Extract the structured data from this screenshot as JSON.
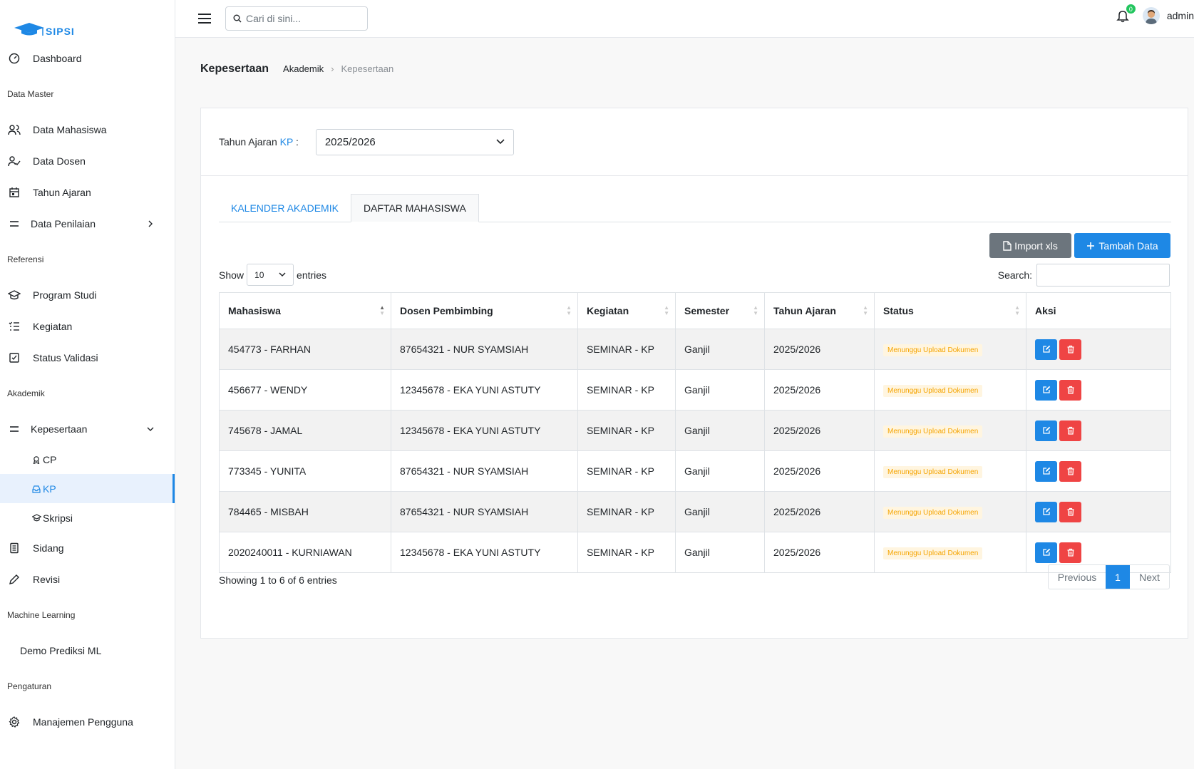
{
  "app": {
    "logo_text": "SIPSI"
  },
  "sidebar": {
    "dashboard": "Dashboard",
    "sections": {
      "data_master": "Data Master",
      "referensi": "Referensi",
      "akademik": "Akademik",
      "machine_learning": "Machine Learning",
      "pengaturan": "Pengaturan"
    },
    "data_master_items": [
      "Data Mahasiswa",
      "Data Dosen",
      "Tahun Ajaran",
      "Data Penilaian"
    ],
    "referensi_items": [
      "Program Studi",
      "Kegiatan",
      "Status Validasi"
    ],
    "kepesertaan": "Kepesertaan",
    "kepesertaan_sub": [
      "CP",
      "KP",
      "Skripsi"
    ],
    "sidang": "Sidang",
    "revisi": "Revisi",
    "demo_ml": "Demo Prediksi ML",
    "manajemen": "Manajemen Pengguna"
  },
  "topbar": {
    "search_placeholder": "Cari di sini...",
    "notif_count": "0",
    "user": "admin"
  },
  "page": {
    "title": "Kepesertaan",
    "breadcrumb": [
      "Akademik",
      "Kepesertaan"
    ]
  },
  "filter": {
    "label_prefix": "Tahun Ajaran ",
    "label_kp": "KP",
    "label_suffix": " :",
    "selected": "2025/2026"
  },
  "tabs": [
    "KALENDER AKADEMIK",
    "DAFTAR MAHASISWA"
  ],
  "buttons": {
    "import": "Import xls",
    "add": "Tambah Data"
  },
  "table_controls": {
    "show": "Show",
    "entries_value": "10",
    "entries": "entries",
    "search_label": "Search:"
  },
  "table": {
    "columns": [
      "Mahasiswa",
      "Dosen Pembimbing",
      "Kegiatan",
      "Semester",
      "Tahun Ajaran",
      "Status",
      "Aksi"
    ],
    "rows": [
      [
        "454773 - FARHAN",
        "87654321 - NUR SYAMSIAH",
        "SEMINAR - KP",
        "Ganjil",
        "2025/2026",
        "Menunggu Upload Dokumen"
      ],
      [
        "456677 - WENDY",
        "12345678 - EKA YUNI ASTUTY",
        "SEMINAR - KP",
        "Ganjil",
        "2025/2026",
        "Menunggu Upload Dokumen"
      ],
      [
        "745678 - JAMAL",
        "12345678 - EKA YUNI ASTUTY",
        "SEMINAR - KP",
        "Ganjil",
        "2025/2026",
        "Menunggu Upload Dokumen"
      ],
      [
        "773345 - YUNITA",
        "87654321 - NUR SYAMSIAH",
        "SEMINAR - KP",
        "Ganjil",
        "2025/2026",
        "Menunggu Upload Dokumen"
      ],
      [
        "784465 - MISBAH",
        "87654321 - NUR SYAMSIAH",
        "SEMINAR - KP",
        "Ganjil",
        "2025/2026",
        "Menunggu Upload Dokumen"
      ],
      [
        "2020240011 - KURNIAWAN",
        "12345678 - EKA YUNI ASTUTY",
        "SEMINAR - KP",
        "Ganjil",
        "2025/2026",
        "Menunggu Upload Dokumen"
      ]
    ]
  },
  "footer": {
    "info": "Showing 1 to 6 of 6 entries",
    "previous": "Previous",
    "page": "1",
    "next": "Next"
  },
  "colors": {
    "primary": "#1e88e5",
    "danger": "#ef4444",
    "secondary": "#6c757d",
    "warning": "#f5a400"
  }
}
